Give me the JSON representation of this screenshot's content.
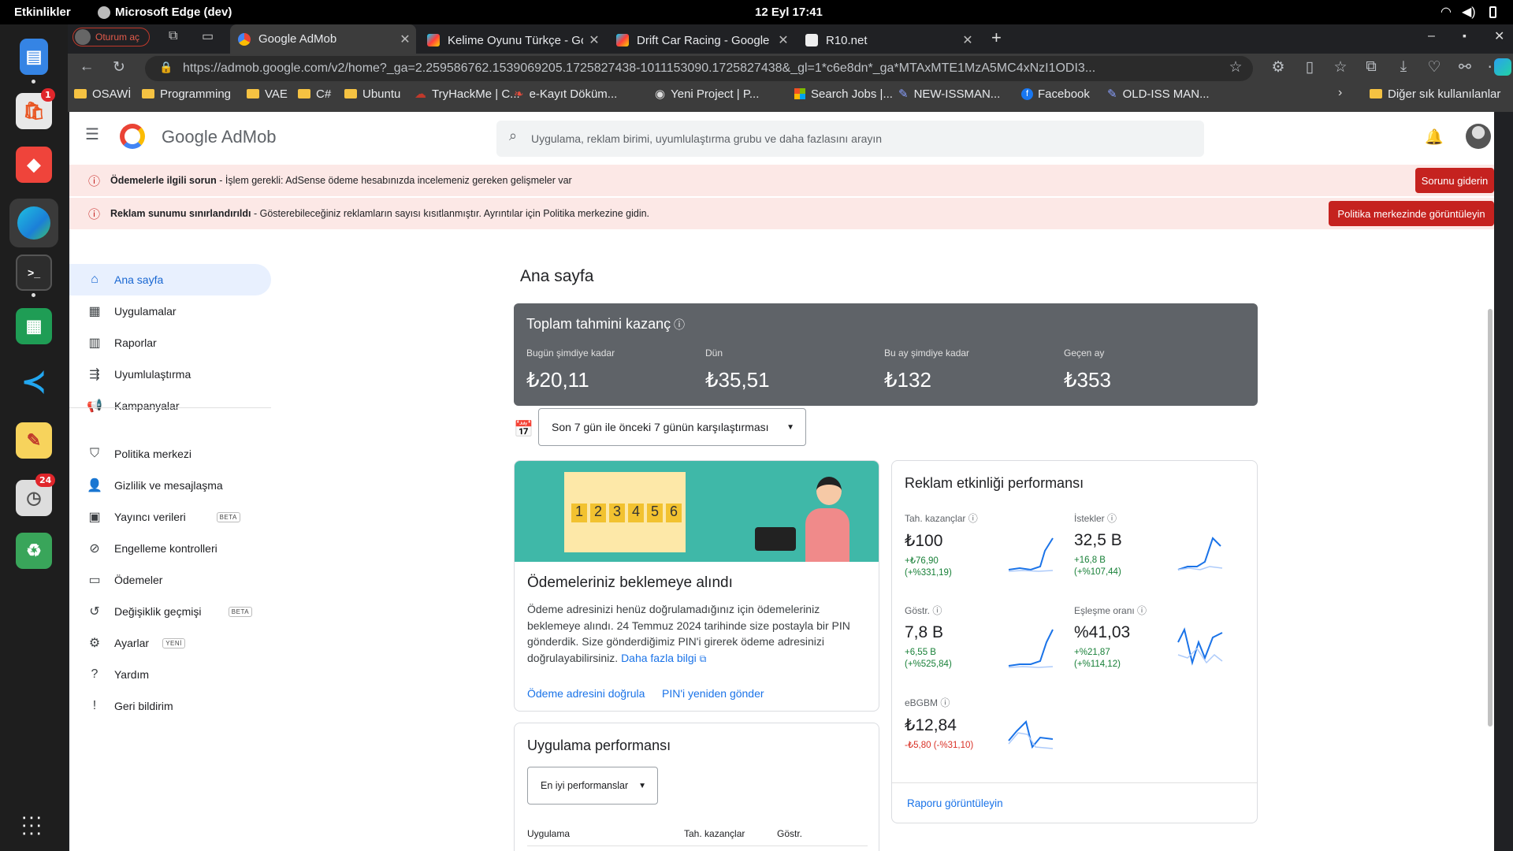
{
  "system": {
    "activities": "Etkinlikler",
    "app_name": "Microsoft Edge (dev)",
    "clock": "12 Eyl  17:41"
  },
  "dock": {
    "badges": {
      "software": "1",
      "calendar": "24"
    }
  },
  "browser": {
    "profile_label": "Oturum aç",
    "tabs": [
      {
        "label": "Google AdMob",
        "active": true
      },
      {
        "label": "Kelime Oyunu Türkçe - Go",
        "active": false
      },
      {
        "label": "Drift Car Racing - Google P",
        "active": false
      },
      {
        "label": "R10.net",
        "active": false
      }
    ],
    "url": "https://admob.google.com/v2/home?_ga=2.259586762.1539069205.1725827438-1011153090.1725827438&_gl=1*c6e8dn*_ga*MTAxMTE1MzA5MC4xNzI1ODI3...",
    "bookmarks": [
      {
        "label": "OSAWİ",
        "icon": "folder"
      },
      {
        "label": "Programming",
        "icon": "folder"
      },
      {
        "label": "VAE",
        "icon": "folder"
      },
      {
        "label": "C#",
        "icon": "folder"
      },
      {
        "label": "Ubuntu",
        "icon": "folder"
      },
      {
        "label": "TryHackMe | C...",
        "icon": "thm"
      },
      {
        "label": "e-Kayıt Döküm...",
        "icon": "ekayit"
      },
      {
        "label": "Yeni Project | P...",
        "icon": "globe"
      },
      {
        "label": "Search Jobs |...",
        "icon": "ms"
      },
      {
        "label": "NEW-ISSMAN...",
        "icon": "pen"
      },
      {
        "label": "Facebook",
        "icon": "facebook"
      },
      {
        "label": "OLD-ISS MAN...",
        "icon": "pen"
      }
    ],
    "other_bookmarks": "Diğer sık kullanılanlar"
  },
  "admob": {
    "logo_text": "Google AdMob",
    "search_placeholder": "Uygulama, reklam birimi, uyumlulaştırma grubu ve daha fazlasını arayın",
    "alerts": [
      {
        "title": "Ödemelerle ilgili sorun",
        "text": " - İşlem gerekli: AdSense ödeme hesabınızda incelemeniz gereken gelişmeler var",
        "button": "Sorunu giderin"
      },
      {
        "title": "Reklam sunumu sınırlandırıldı",
        "text": " - Gösterebileceğiniz reklamların sayısı kısıtlanmıştır. Ayrıntılar için Politika merkezine gidin.",
        "button": "Politika merkezinde görüntüleyin"
      }
    ],
    "nav": [
      {
        "label": "Ana sayfa",
        "icon": "home-icon",
        "glyph": "⌂",
        "tag": ""
      },
      {
        "label": "Uygulamalar",
        "icon": "apps-icon",
        "glyph": "▦",
        "tag": ""
      },
      {
        "label": "Raporlar",
        "icon": "reports-icon",
        "glyph": "▥",
        "tag": ""
      },
      {
        "label": "Uyumlulaştırma",
        "icon": "mediation-icon",
        "glyph": "⇶",
        "tag": ""
      },
      {
        "label": "Kampanyalar",
        "icon": "campaigns-icon",
        "glyph": "📢",
        "tag": ""
      },
      {
        "label": "Politika merkezi",
        "icon": "policy-icon",
        "glyph": "⛉",
        "tag": ""
      },
      {
        "label": "Gizlilik ve mesajlaşma",
        "icon": "privacy-icon",
        "glyph": "👤",
        "tag": ""
      },
      {
        "label": "Yayıncı verileri",
        "icon": "publisher-data-icon",
        "glyph": "▣",
        "tag": "BETA"
      },
      {
        "label": "Engelleme kontrolleri",
        "icon": "blocking-icon",
        "glyph": "⊘",
        "tag": ""
      },
      {
        "label": "Ödemeler",
        "icon": "payments-icon",
        "glyph": "▭",
        "tag": ""
      },
      {
        "label": "Değişiklik geçmişi",
        "icon": "history-icon",
        "glyph": "↺",
        "tag": "BETA"
      },
      {
        "label": "Ayarlar",
        "icon": "settings-icon",
        "glyph": "⚙",
        "tag": "YENİ"
      },
      {
        "label": "Yardım",
        "icon": "help-icon",
        "glyph": "?",
        "tag": ""
      },
      {
        "label": "Geri bildirim",
        "icon": "feedback-icon",
        "glyph": "!",
        "tag": ""
      }
    ],
    "page_title": "Ana sayfa",
    "earnings": {
      "title": "Toplam tahmini kazanç",
      "items": [
        {
          "label": "Bugün şimdiye kadar",
          "value": "₺20,11"
        },
        {
          "label": "Dün",
          "value": "₺35,51"
        },
        {
          "label": "Bu ay şimdiye kadar",
          "value": "₺132"
        },
        {
          "label": "Geçen ay",
          "value": "₺353"
        }
      ]
    },
    "date_range": "Son 7 gün ile önceki 7 günün karşılaştırması",
    "payment_card": {
      "pin_digits": [
        "1",
        "2",
        "3",
        "4",
        "5",
        "6"
      ],
      "title": "Ödemeleriniz beklemeye alındı",
      "body": "Ödeme adresinizi henüz doğrulamadığınız için ödemeleriniz beklemeye alındı. 24 Temmuz 2024 tarihinde size postayla bir PIN gönderdik. Size gönderdiğimiz PIN'i girerek ödeme adresinizi doğrulayabilirsiniz.",
      "learn_more": "Daha fazla bilgi",
      "action1": "Ödeme adresini doğrula",
      "action2": "PIN'i yeniden gönder"
    },
    "performance": {
      "title": "Reklam etkinliği performansı",
      "metrics": [
        {
          "label": "Tah. kazançlar",
          "value": "₺100",
          "delta1": "+₺76,90",
          "delta2": "(+%331,19)",
          "positive": true
        },
        {
          "label": "İstekler",
          "value": "32,5 B",
          "delta1": "+16,8 B",
          "delta2": "(+%107,44)",
          "positive": true
        },
        {
          "label": "Göstr.",
          "value": "7,8 B",
          "delta1": "+6,55 B",
          "delta2": "(+%525,84)",
          "positive": true
        },
        {
          "label": "Eşleşme oranı",
          "value": "%41,03",
          "delta1": "+%21,87",
          "delta2": "(+%114,12)",
          "positive": true
        },
        {
          "label": "eBGBM",
          "value": "₺12,84",
          "delta1": "-₺5,80 (-%31,10)",
          "delta2": "",
          "positive": false
        }
      ],
      "report_link": "Raporu görüntüleyin"
    },
    "app_perf": {
      "title": "Uygulama performansı",
      "select": "En iyi performanslar",
      "columns": [
        "Uygulama",
        "Tah. kazançlar",
        "Göstr."
      ]
    }
  }
}
